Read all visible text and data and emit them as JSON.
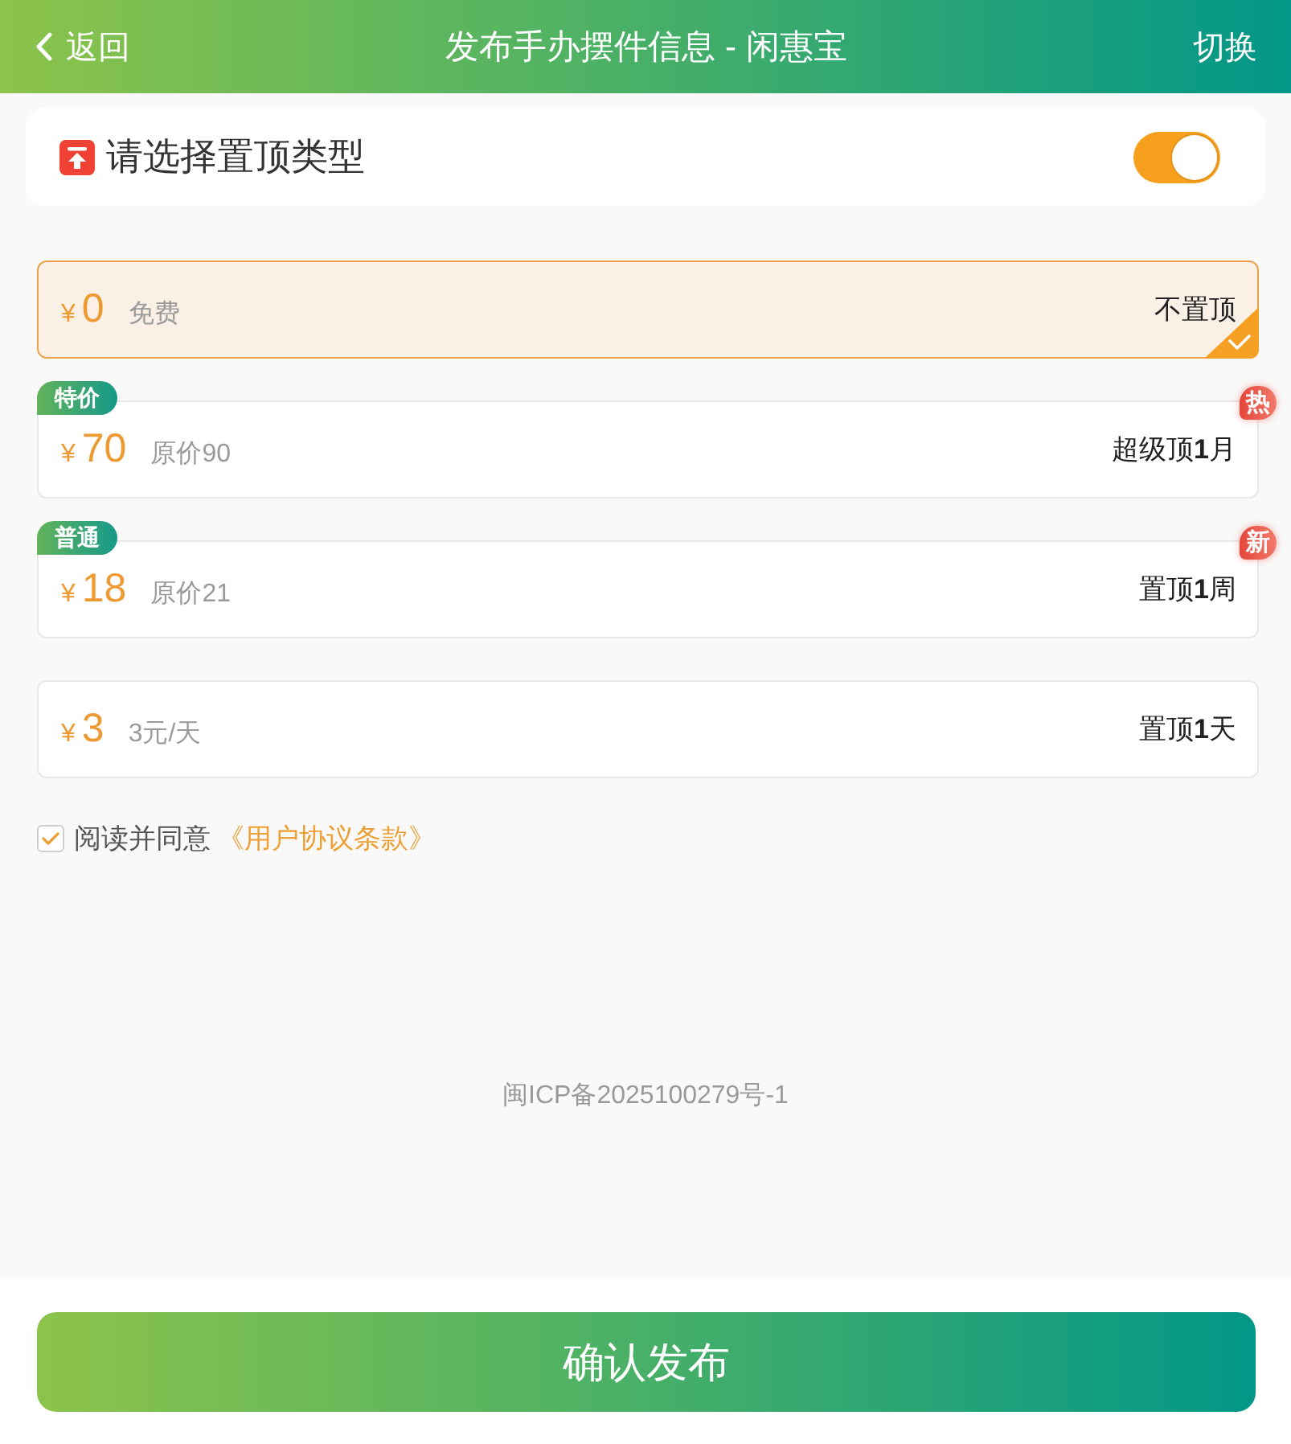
{
  "header": {
    "back_label": "返回",
    "title": "发布手办摆件信息 - 闲惠宝",
    "switch_label": "切换"
  },
  "top_type": {
    "label": "请选择置顶类型",
    "on": true
  },
  "options": [
    {
      "currency": "¥",
      "amount": "0",
      "note": "免费",
      "label": "不置顶",
      "selected": true
    },
    {
      "tag": "特价",
      "currency": "¥",
      "amount": "70",
      "note": "原价90",
      "label": "超级顶**1**月",
      "badge": "热",
      "selected": false
    },
    {
      "tag": "普通",
      "currency": "¥",
      "amount": "18",
      "note": "原价21",
      "label": "置顶**1**周",
      "badge": "新",
      "selected": false
    },
    {
      "currency": "¥",
      "amount": "3",
      "note": "3元/天",
      "label": "置顶**1**天",
      "selected": false
    }
  ],
  "agreement": {
    "checked": true,
    "text": "阅读并同意",
    "link": "《用户协议条款》"
  },
  "footer": {
    "icp": "闽ICP备2025100279号-1"
  },
  "submit_button": "确认发布"
}
